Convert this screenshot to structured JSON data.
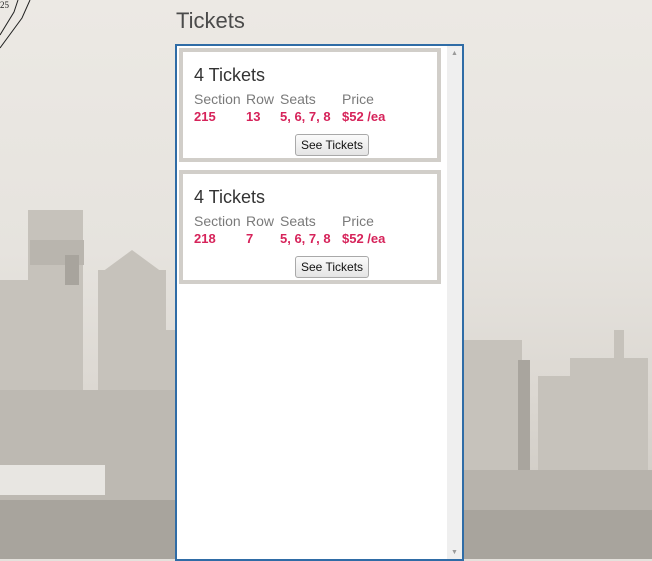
{
  "page": {
    "heading": "Tickets"
  },
  "stadium_map": {
    "label": "25"
  },
  "listings": [
    {
      "title": "4 Tickets",
      "section_label": "Section",
      "section": "215",
      "row_label": "Row",
      "row": "13",
      "seats_label": "Seats",
      "seats": "5, 6, 7, 8",
      "price_label": "Price",
      "price": "$52 /ea",
      "button_label": "See Tickets"
    },
    {
      "title": "4 Tickets",
      "section_label": "Section",
      "section": "218",
      "row_label": "Row",
      "row": "7",
      "seats_label": "Seats",
      "seats": "5, 6, 7, 8",
      "price_label": "Price",
      "price": "$52 /ea",
      "button_label": "See Tickets"
    }
  ],
  "scrollbar": {
    "up_icon": "arrow-up-icon",
    "down_icon": "arrow-down-icon"
  },
  "colors": {
    "accent": "#d6235a",
    "panel_border": "#2f6ca6",
    "card_border": "#d1cec9"
  }
}
